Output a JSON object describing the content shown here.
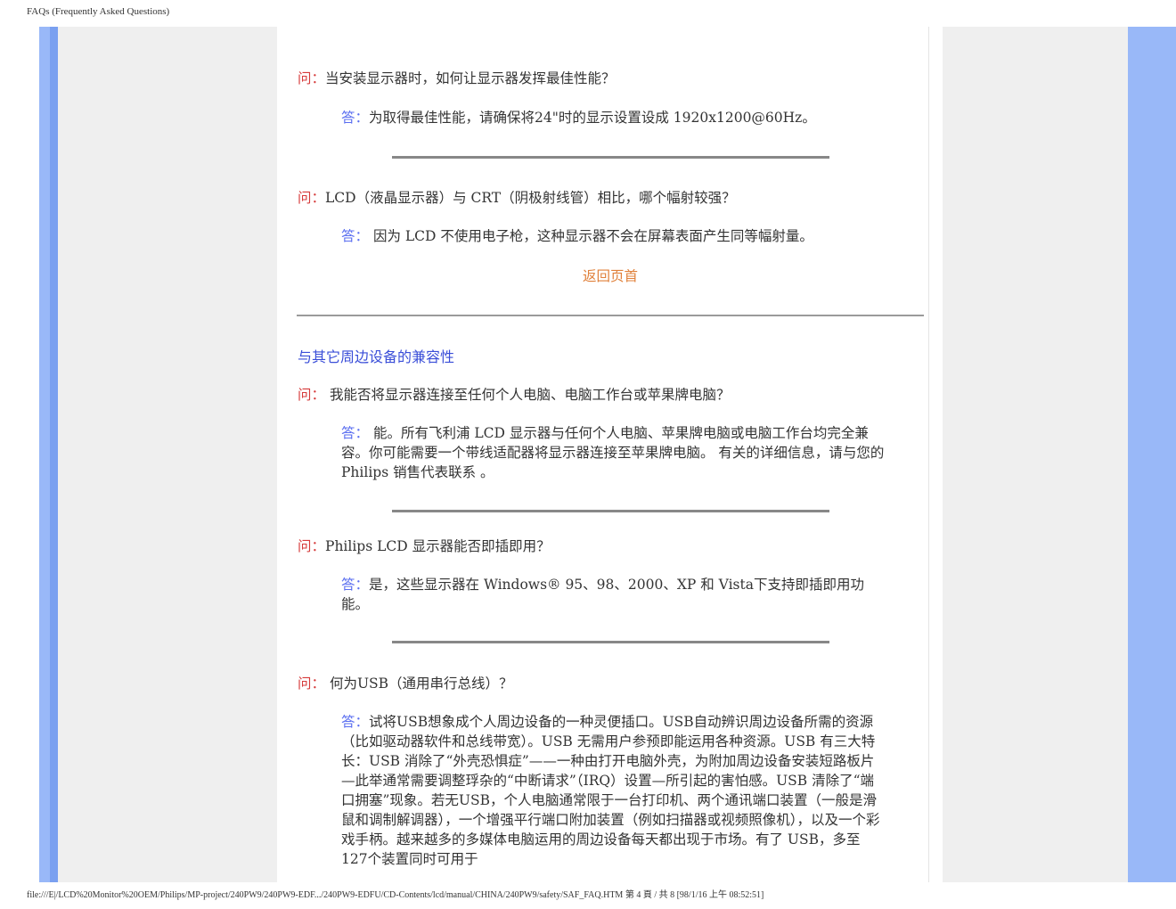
{
  "print_header": "FAQs (Frequently Asked Questions)",
  "print_footer": "file:///E|/LCD%20Monitor%20OEM/Philips/MP-project/240PW9/240PW9-EDF.../240PW9-EDFU/CD-Contents/lcd/manual/CHINA/240PW9/safety/SAF_FAQ.HTM 第 4 頁 / 共 8  [98/1/16 上午 08:52:51]",
  "q_label": "问：",
  "a_label": "答：",
  "faq1": {
    "question": "当安装显示器时，如何让显示器发挥最佳性能？",
    "answer": "为取得最佳性能，请确保将24\"时的显示设置设成 1920x1200@60Hz。"
  },
  "faq2": {
    "question": "LCD（液晶显示器）与 CRT（阴极射线管）相比，哪个幅射较强？",
    "answer": " 因为 LCD 不使用电子枪，这种显示器不会在屏幕表面产生同等幅射量。"
  },
  "back_to_top": "返回页首",
  "section_title": "与其它周边设备的兼容性",
  "faq3": {
    "question": " 我能否将显示器连接至任何个人电脑、电脑工作台或苹果牌电脑？",
    "answer": " 能。所有飞利浦 LCD 显示器与任何个人电脑、苹果牌电脑或电脑工作台均完全兼容。你可能需要一个带线适配器将显示器连接至苹果牌电脑。 有关的详细信息，请与您的 Philips 销售代表联系 。"
  },
  "faq4": {
    "question": "Philips LCD 显示器能否即插即用？",
    "answer": "是，这些显示器在 Windows® 95、98、2000、XP 和 Vista下支持即插即用功能。"
  },
  "faq5": {
    "question": " 何为USB（通用串行总线）？",
    "answer": "试将USB想象成个人周边设备的一种灵便插口。USB自动辨识周边设备所需的资源（比如驱动器软件和总线带宽）。USB 无需用户参预即能运用各种资源。USB 有三大特长：USB 消除了“外壳恐惧症”——一种由打开电脑外壳，为附加周边设备安装短路板片—此举通常需要调整琈杂的“中断请求”（IRQ）设置—所引起的害怕感。USB 清除了“端口拥塞”现象。若无USB，个人电脑通常限于一台打印机、两个通讯端口装置（一般是滑鼠和调制解调器），一个增强平行端口附加装置（例如扫描器或视频照像机），以及一个彩戏手柄。越来越多的多媒体电脑运用的周边设备每天都出现于市场。有了 USB，多至 127个装置同时可用于"
  }
}
